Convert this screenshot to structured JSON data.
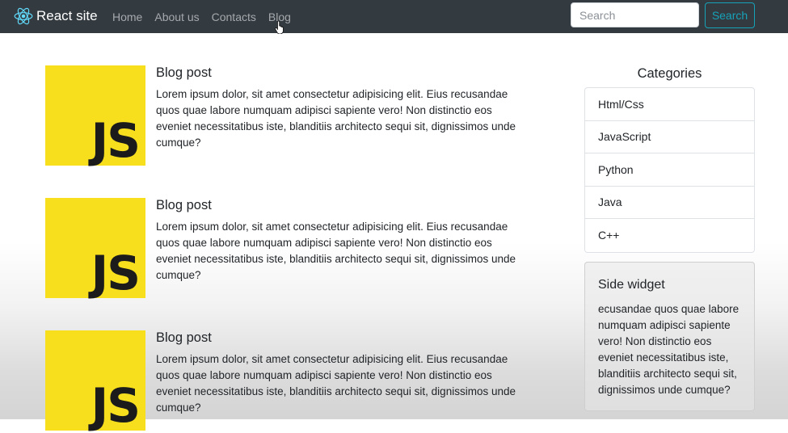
{
  "navbar": {
    "brand": "React site",
    "links": [
      "Home",
      "About us",
      "Contacts",
      "Blog"
    ],
    "search_placeholder": "Search",
    "search_button": "Search",
    "colors": {
      "background": "#333a40",
      "brand_icon": "#61dafb",
      "search_button": "#17a2b8"
    }
  },
  "posts": [
    {
      "thumb_text": "JS",
      "title": "Blog post",
      "text": "Lorem ipsum dolor, sit amet consectetur adipisicing elit. Eius recusandae quos quae labore numquam adipisci sapiente vero! Non distinctio eos eveniet necessitatibus iste, blanditiis architecto sequi sit, dignissimos unde cumque?"
    },
    {
      "thumb_text": "JS",
      "title": "Blog post",
      "text": "Lorem ipsum dolor, sit amet consectetur adipisicing elit. Eius recusandae quos quae labore numquam adipisci sapiente vero! Non distinctio eos eveniet necessitatibus iste, blanditiis architecto sequi sit, dignissimos unde cumque?"
    },
    {
      "thumb_text": "JS",
      "title": "Blog post",
      "text": "Lorem ipsum dolor, sit amet consectetur adipisicing elit. Eius recusandae quos quae labore numquam adipisci sapiente vero! Non distinctio eos eveniet necessitatibus iste, blanditiis architecto sequi sit, dignissimos unde cumque?"
    }
  ],
  "sidebar": {
    "categories_title": "Categories",
    "categories": [
      "Html/Css",
      "JavaScript",
      "Python",
      "Java",
      "C++"
    ],
    "widget": {
      "title": "Side widget",
      "text": "ecusandae quos quae labore numquam adipisci sapiente vero! Non distinctio eos eveniet necessitatibus iste, blanditiis architecto sequi sit, dignissimos unde cumque?"
    }
  },
  "icons": {
    "brand": "react-logo-icon",
    "cursor": "hand-pointer-icon"
  },
  "thumb_color": "#f7df1e"
}
